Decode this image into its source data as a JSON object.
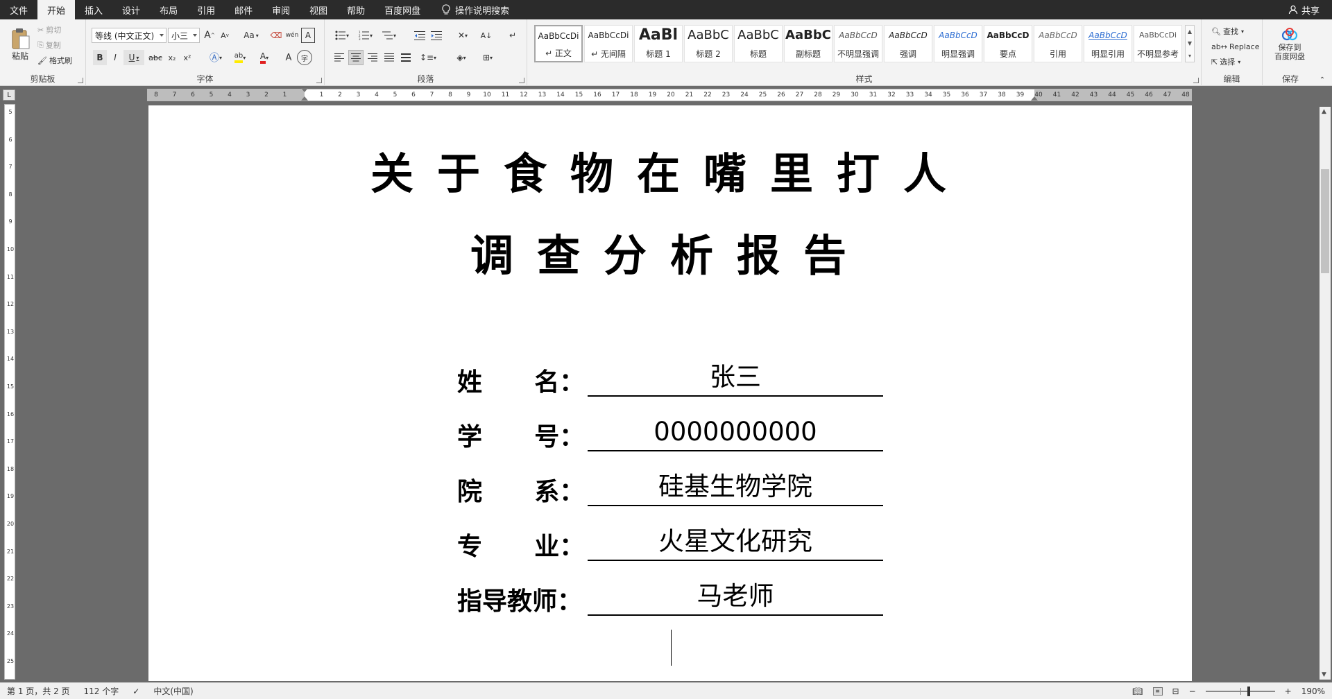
{
  "menu": {
    "tabs": [
      {
        "label": "文件"
      },
      {
        "label": "开始",
        "active": true
      },
      {
        "label": "插入"
      },
      {
        "label": "设计"
      },
      {
        "label": "布局"
      },
      {
        "label": "引用"
      },
      {
        "label": "邮件"
      },
      {
        "label": "审阅"
      },
      {
        "label": "视图"
      },
      {
        "label": "帮助"
      },
      {
        "label": "百度网盘"
      }
    ],
    "tell_me": "操作说明搜索",
    "share": "共享"
  },
  "ribbon": {
    "clipboard": {
      "paste": "粘贴",
      "cut": "剪切",
      "copy": "复制",
      "format_painter": "格式刷",
      "label": "剪贴板"
    },
    "font": {
      "name": "等线 (中文正文)",
      "size": "小三",
      "aa": "Aa",
      "label": "字体",
      "bold": "B",
      "italic": "I",
      "underline": "U",
      "strike": "abc",
      "sub": "x₂",
      "sup": "x²",
      "highlight": "ab",
      "color_a": "A",
      "char_a": "A",
      "encircle": "字",
      "phonetic": "wén",
      "grow": "A",
      "shrink": "A"
    },
    "paragraph": {
      "label": "段落"
    },
    "styles": {
      "label": "样式",
      "items": [
        {
          "preview": "AaBbCcDi",
          "name": "↵ 正文",
          "selected": true
        },
        {
          "preview": "AaBbCcDi",
          "name": "↵ 无间隔"
        },
        {
          "preview": "AaBl",
          "name": "标题 1"
        },
        {
          "preview": "AaBbC",
          "name": "标题 2"
        },
        {
          "preview": "AaBbC",
          "name": "标题"
        },
        {
          "preview": "AaBbC",
          "name": "副标题"
        },
        {
          "preview": "AaBbCcD",
          "name": "不明显强调"
        },
        {
          "preview": "AaBbCcD",
          "name": "强调"
        },
        {
          "preview": "AaBbCcD",
          "name": "明显强调"
        },
        {
          "preview": "AaBbCcD",
          "name": "要点"
        },
        {
          "preview": "AaBbCcD",
          "name": "引用"
        },
        {
          "preview": "AaBbCcD",
          "name": "明显引用"
        },
        {
          "preview": "AaBbCcDi",
          "name": "不明显参考"
        }
      ]
    },
    "editing": {
      "find": "查找",
      "replace": "Replace",
      "select": "选择",
      "label": "编辑"
    },
    "save": {
      "line1": "保存到",
      "line2": "百度网盘",
      "label": "保存"
    }
  },
  "ruler": {
    "h_ticks": [
      "8",
      "7",
      "6",
      "5",
      "4",
      "3",
      "2",
      "1",
      "",
      "1",
      "2",
      "3",
      "4",
      "5",
      "6",
      "7",
      "8",
      "9",
      "10",
      "11",
      "12",
      "13",
      "14",
      "15",
      "16",
      "17",
      "18",
      "19",
      "20",
      "21",
      "22",
      "23",
      "24",
      "25",
      "26",
      "27",
      "28",
      "29",
      "30",
      "31",
      "32",
      "33",
      "34",
      "35",
      "36",
      "37",
      "38",
      "39",
      "40",
      "41",
      "42",
      "43",
      "44",
      "45",
      "46",
      "47",
      "48"
    ],
    "v_ticks": [
      "5",
      "6",
      "7",
      "8",
      "9",
      "10",
      "11",
      "12",
      "13",
      "14",
      "15",
      "16",
      "17",
      "18",
      "19",
      "20",
      "21",
      "22",
      "23",
      "24",
      "25"
    ],
    "corner": "L"
  },
  "document": {
    "title_line1": "关于食物在嘴里打人",
    "title_line2": "调查分析报告",
    "fields": [
      {
        "label": "姓      名：",
        "value": "张三"
      },
      {
        "label": "学      号：",
        "value": "0000000000"
      },
      {
        "label": "院      系：",
        "value": "硅基生物学院"
      },
      {
        "label": "专      业：",
        "value": "火星文化研究"
      },
      {
        "label": "指导教师：",
        "value": "马老师"
      }
    ]
  },
  "status": {
    "page": "第 1 页，共 2 页",
    "words": "112 个字",
    "language": "中文(中国)",
    "zoom": "190%",
    "zoom_percent": 60
  }
}
